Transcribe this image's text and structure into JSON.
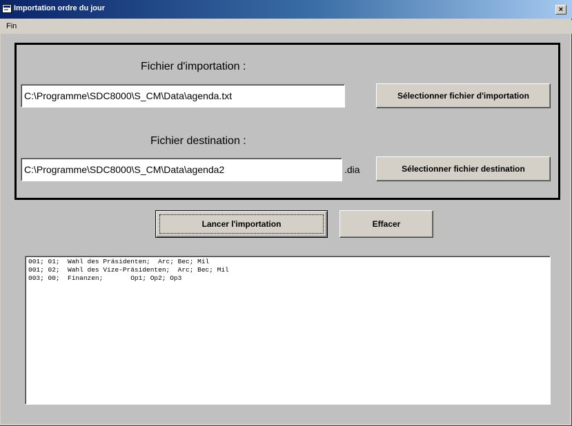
{
  "window": {
    "title": "Importation ordre du jour",
    "close_label": "×"
  },
  "menu": {
    "items": [
      "Fin"
    ]
  },
  "import_section": {
    "title": "Fichier d'importation :",
    "path_value": "C:\\Programme\\SDC8000\\S_CM\\Data\\agenda.txt",
    "select_button_label": "Sélectionner fichier d'importation"
  },
  "destination_section": {
    "title": "Fichier destination :",
    "path_value": "C:\\Programme\\SDC8000\\S_CM\\Data\\agenda2",
    "extension": ".dia",
    "select_button_label": "Sélectionner fichier destination"
  },
  "actions": {
    "launch_label": "Lancer l'importation",
    "clear_label": "Effacer"
  },
  "output": {
    "lines": [
      "001; 01;  Wahl des Präsidenten;  Arc; Bec; Mil",
      "001; 02;  Wahl des Vize-Präsidenten;  Arc; Bec; Mil",
      "003; 00;  Finanzen;       Op1; Op2; Op3"
    ]
  },
  "colors": {
    "titlebar_start": "#0a246a",
    "titlebar_end": "#a6caf0",
    "face": "#d4d0c8",
    "client": "#c0c0c0"
  }
}
